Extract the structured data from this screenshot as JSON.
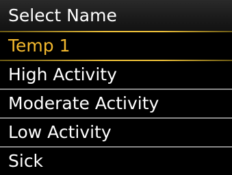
{
  "header": {
    "title": "Select Name"
  },
  "menu": {
    "items": [
      {
        "label": "Temp 1",
        "selected": true
      },
      {
        "label": "High Activity",
        "selected": false
      },
      {
        "label": "Moderate Activity",
        "selected": false
      },
      {
        "label": "Low Activity",
        "selected": false
      },
      {
        "label": "Sick",
        "selected": false
      }
    ]
  },
  "colors": {
    "background": "#000000",
    "header_bg": "#1a1a1a",
    "text": "#ffffff",
    "selected_text": "#f2b82e",
    "selected_border": "#f2c43a",
    "divider": "#8a8a8a"
  }
}
